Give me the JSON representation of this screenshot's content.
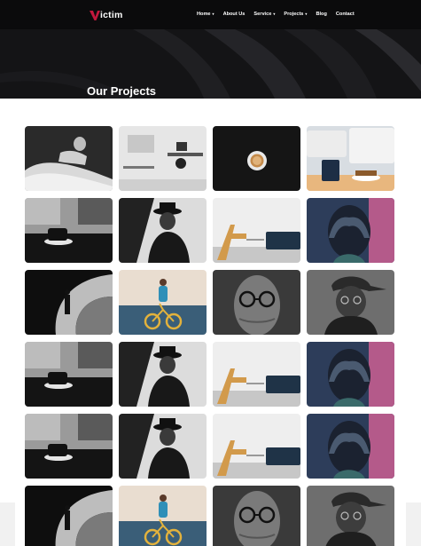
{
  "brand": {
    "name": "ictim",
    "mark_color": "#c2183d"
  },
  "nav": [
    {
      "label": "Home",
      "has_dropdown": true
    },
    {
      "label": "About Us",
      "has_dropdown": false
    },
    {
      "label": "Service",
      "has_dropdown": true
    },
    {
      "label": "Projects",
      "has_dropdown": true,
      "active": true
    },
    {
      "label": "Blog",
      "has_dropdown": false
    },
    {
      "label": "Contact",
      "has_dropdown": false
    }
  ],
  "hero": {
    "title": "Our Projects",
    "accent_color": "#c2183d"
  },
  "projects": [
    {
      "image": "woman-lying-bw"
    },
    {
      "image": "office-desk-bw"
    },
    {
      "image": "coffee-cup-top-dark"
    },
    {
      "image": "love-cushion-mug"
    },
    {
      "image": "coffee-cup-window"
    },
    {
      "image": "man-hat-portrait"
    },
    {
      "image": "living-room-chair"
    },
    {
      "image": "hands-over-eyes"
    },
    {
      "image": "tunnel-silhouette"
    },
    {
      "image": "girl-yellow-bike"
    },
    {
      "image": "glasses-bandaged-face"
    },
    {
      "image": "cap-man-thinking"
    },
    {
      "image": "coffee-cup-window"
    },
    {
      "image": "man-hat-portrait"
    },
    {
      "image": "living-room-chair"
    },
    {
      "image": "hands-over-eyes"
    },
    {
      "image": "coffee-cup-window"
    },
    {
      "image": "man-hat-portrait"
    },
    {
      "image": "living-room-chair"
    },
    {
      "image": "hands-over-eyes"
    },
    {
      "image": "tunnel-silhouette"
    },
    {
      "image": "girl-yellow-bike"
    },
    {
      "image": "glasses-bandaged-face"
    },
    {
      "image": "cap-man-thinking"
    }
  ]
}
